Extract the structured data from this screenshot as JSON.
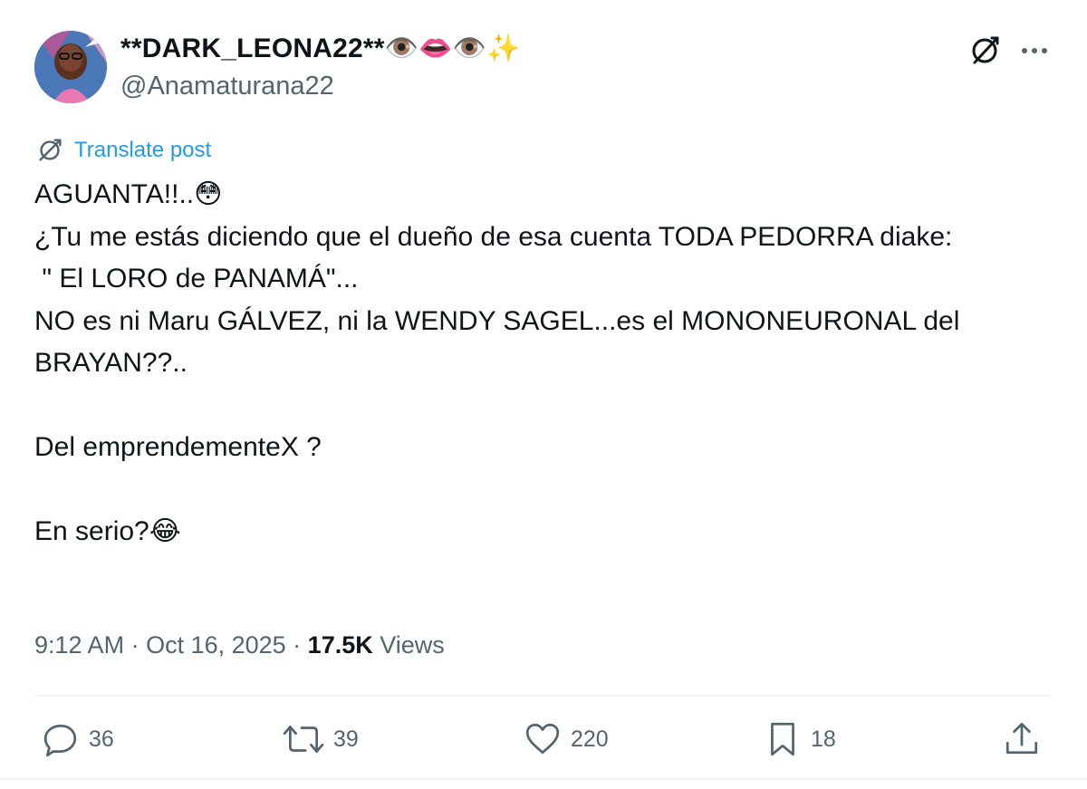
{
  "author": {
    "display_name": "**DARK_LEONA22**👁️👄👁️✨",
    "handle": "@Anamaturana22"
  },
  "header_icons": [
    "grok-icon",
    "more-icon"
  ],
  "translate": {
    "label": "Translate post",
    "icon": "translate-icon"
  },
  "post": {
    "text": "AGUANTA!!..😳\n¿Tu me estás diciendo que el dueño de esa cuenta TODA PEDORRA diake:\n \" El LORO de PANAMÁ\"...\nNO es ni Maru GÁLVEZ, ni la WENDY SAGEL...es el MONONEURONAL del BRAYAN??..\n\nDel emprendementeX ?\n\nEn serio?😂"
  },
  "meta": {
    "time": "9:12 AM",
    "separator": " · ",
    "date": "Oct 16, 2025",
    "views_count": "17.5K",
    "views_label": "Views"
  },
  "actions": {
    "replies": {
      "count": "36",
      "icon": "reply-icon"
    },
    "reposts": {
      "count": "39",
      "icon": "repost-icon"
    },
    "likes": {
      "count": "220",
      "icon": "like-icon"
    },
    "bookmarks": {
      "count": "18",
      "icon": "bookmark-icon"
    },
    "share": {
      "icon": "share-icon"
    }
  },
  "colors": {
    "text": "#0f1419",
    "secondary": "#536471",
    "link": "#1d9bf0",
    "divider": "#eff3f4"
  }
}
